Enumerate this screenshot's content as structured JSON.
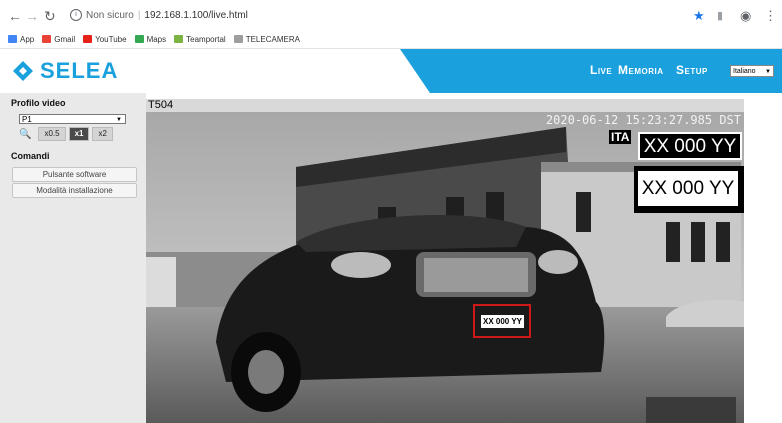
{
  "browser": {
    "not_secure": "Non sicuro",
    "url": "192.168.1.100/live.html",
    "bookmarks": [
      "App",
      "Gmail",
      "YouTube",
      "Maps",
      "Teamportal",
      "TELECAMERA"
    ]
  },
  "header": {
    "logo_text": "SELEA",
    "nav": [
      "Live",
      "Memoria",
      "Setup"
    ],
    "language": "Italiano"
  },
  "sidebar": {
    "profile_title": "Profilo video",
    "profile_value": "P1",
    "zoom_options": [
      "x0.5",
      "x1",
      "x2"
    ],
    "zoom_active": "x1",
    "commands_title": "Comandi",
    "buttons": [
      "Pulsante software",
      "Modalità installazione"
    ]
  },
  "camera": {
    "name": "T504",
    "timestamp": "2020-06-12 15:23:27.985 DST",
    "country": "ITA",
    "plate_text": "XX 000 YY",
    "plate_crop": "XX 000 YY",
    "plate_on_car": "XX 000 YY"
  },
  "colors": {
    "brand": "#1aa0dd",
    "roi": "#d01818"
  }
}
